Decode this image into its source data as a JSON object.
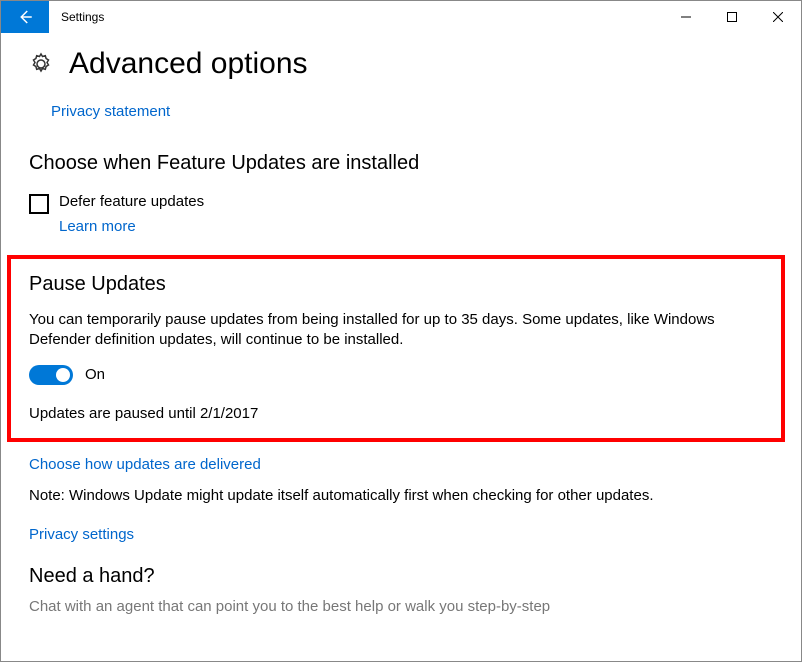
{
  "app_title": "Settings",
  "page_title": "Advanced options",
  "links": {
    "privacy_statement": "Privacy statement",
    "learn_more": "Learn more",
    "delivered": "Choose how updates are delivered",
    "privacy_settings": "Privacy settings"
  },
  "sections": {
    "choose_heading": "Choose when Feature Updates are installed",
    "defer_label": "Defer feature updates",
    "pause_heading": "Pause Updates",
    "pause_desc": "You can temporarily pause updates from being installed for up to 35 days. Some updates, like Windows Defender definition updates, will continue to be installed.",
    "toggle_state": "On",
    "pause_status": "Updates are paused until 2/1/2017",
    "note": "Note: Windows Update might update itself automatically first when checking for other updates.",
    "need_hand": "Need a hand?",
    "chat_text": "Chat with an agent that can point you to the best help or walk you step-by-step"
  }
}
